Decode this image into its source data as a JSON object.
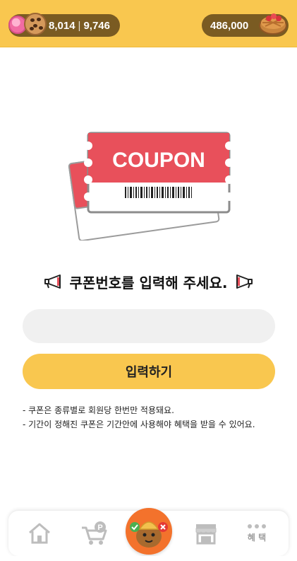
{
  "header": {
    "candy_count": "8,014",
    "cookie_count": "9,746",
    "pie_count": "486,000",
    "separator": "|"
  },
  "coupon": {
    "ticket_text": "COUPON"
  },
  "main": {
    "prompt": "쿠폰번호를 입력해 주세요.",
    "input_placeholder": "",
    "submit_label": "입력하기",
    "notes": [
      "- 쿠폰은 종류별로 회원당 한번만 적용돼요.",
      "- 기간이 정해진 쿠폰은 기간안에 사용해야 혜택을 받을 수 있어요."
    ]
  },
  "nav": {
    "items": [
      "home-icon",
      "point-cart-icon",
      "game-icon",
      "store-icon",
      "more-icon"
    ],
    "more_label": "혜 택"
  },
  "colors": {
    "header_bg": "#f9c74f",
    "pill_bg": "#7a5b22",
    "ticket_red": "#e8505b",
    "button_yellow": "#f9c74f",
    "input_bg": "#f0f0f0"
  }
}
